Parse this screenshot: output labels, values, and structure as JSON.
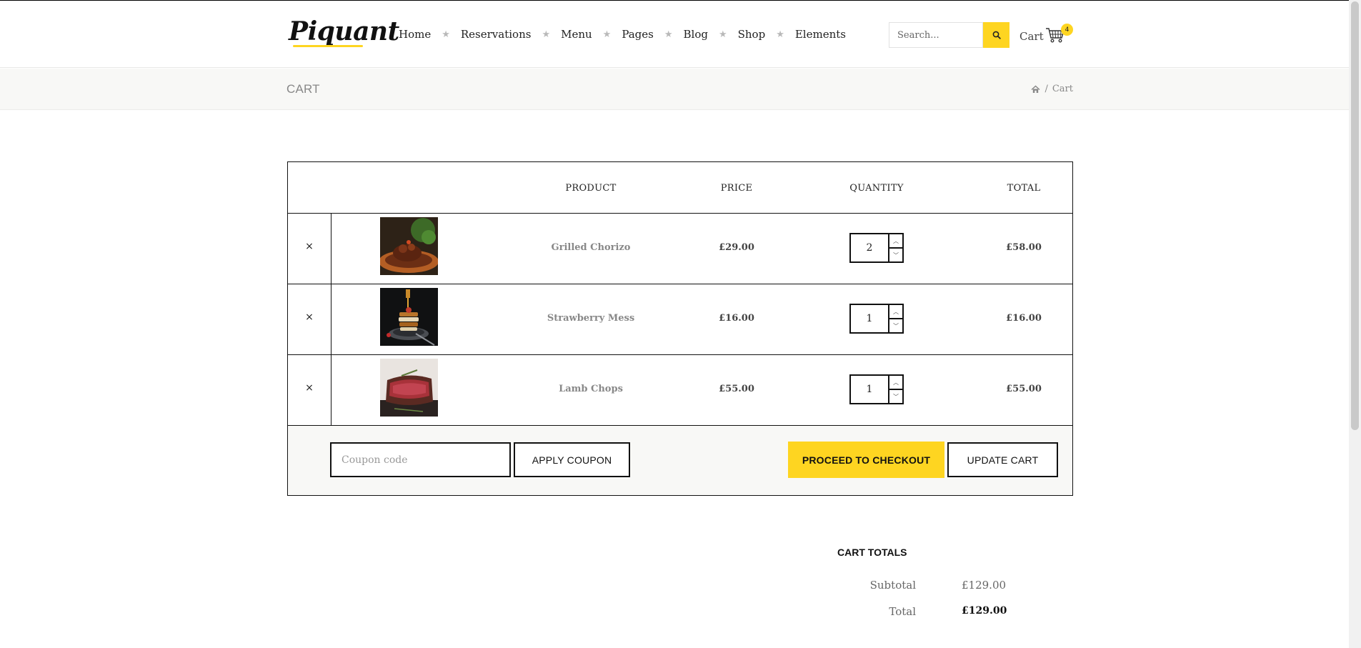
{
  "brand": {
    "name": "Piquant"
  },
  "nav": {
    "items": [
      "Home",
      "Reservations",
      "Menu",
      "Pages",
      "Blog",
      "Shop",
      "Elements"
    ],
    "separator": "★"
  },
  "header": {
    "search_placeholder": "Search...",
    "search_icon": "search-icon",
    "cart_label": "Cart",
    "cart_icon": "cart-icon",
    "cart_count": "4"
  },
  "titlebar": {
    "title": "CART",
    "breadcrumb": {
      "home_icon": "home-icon",
      "separator": "/",
      "current": "Cart"
    }
  },
  "cart": {
    "columns": [
      "PRODUCT",
      "PRICE",
      "QUANTITY",
      "TOTAL"
    ],
    "remove_symbol": "×",
    "rows": [
      {
        "name": "Grilled Chorizo",
        "price": "£29.00",
        "quantity": "2",
        "total": "£58.00",
        "image": "grilled-chorizo-image"
      },
      {
        "name": "Strawberry Mess",
        "price": "£16.00",
        "quantity": "1",
        "total": "£16.00",
        "image": "strawberry-mess-image"
      },
      {
        "name": "Lamb Chops",
        "price": "£55.00",
        "quantity": "1",
        "total": "£55.00",
        "image": "lamb-chops-image"
      }
    ],
    "coupon_placeholder": "Coupon code",
    "apply_coupon_label": "APPLY COUPON",
    "checkout_label": "PROCEED TO CHECKOUT",
    "update_label": "UPDATE CART"
  },
  "totals": {
    "title": "CART TOTALS",
    "subtotal_label": "Subtotal",
    "subtotal_value": "£129.00",
    "total_label": "Total",
    "total_value": "£129.00"
  },
  "colors": {
    "accent": "#fed521",
    "border": "#111111",
    "muted_bg": "#f8f8f6"
  }
}
